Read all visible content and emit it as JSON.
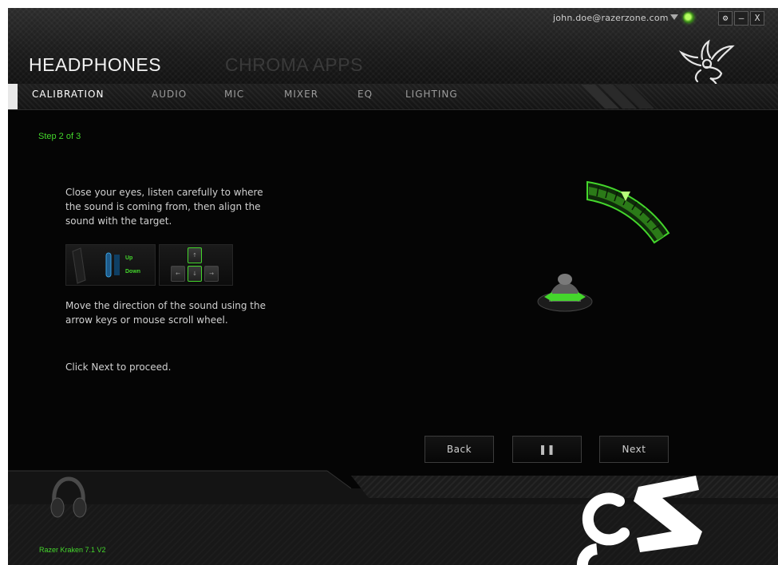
{
  "window": {
    "user_email": "john.doe@razerzone.com",
    "settings_label": "⚙",
    "minimize_label": "–",
    "close_label": "X"
  },
  "header": {
    "title": "HEADPHONES",
    "secondary_title": "CHROMA APPS"
  },
  "tabs": [
    {
      "label": "CALIBRATION",
      "active": true
    },
    {
      "label": "AUDIO",
      "active": false
    },
    {
      "label": "MIC",
      "active": false
    },
    {
      "label": "MIXER",
      "active": false
    },
    {
      "label": "EQ",
      "active": false
    },
    {
      "label": "LIGHTING",
      "active": false
    }
  ],
  "content": {
    "step": "Step 2 of 3",
    "instruction_1": "Close your eyes, listen carefully to where the sound is coming from, then align the sound with the target.",
    "hint_up": "Up",
    "hint_down": "Down",
    "instruction_2": "Move the direction of the sound using the arrow keys or mouse scroll wheel.",
    "instruction_3": "Click Next to proceed."
  },
  "buttons": {
    "back": "Back",
    "pause": "❚❚",
    "next": "Next"
  },
  "footer": {
    "device_name": "Razer Kraken 7.1 V2"
  },
  "colors": {
    "accent": "#44d62c",
    "background": "#050505",
    "text": "#d0d0d0"
  },
  "icons": [
    "user-dropdown-icon",
    "status-icon",
    "gear-icon",
    "minimize-icon",
    "close-icon",
    "razer-logo",
    "pause-icon",
    "headset-icon"
  ]
}
